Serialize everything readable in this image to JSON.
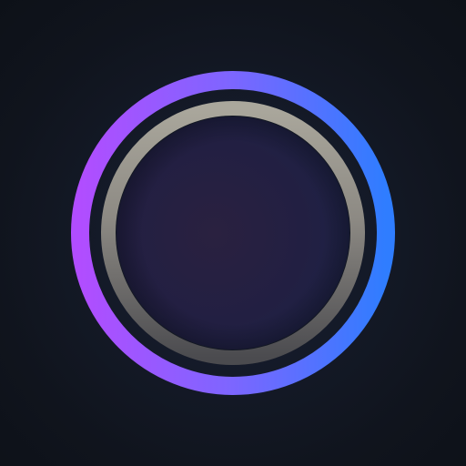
{
  "app": {
    "screen": "circular-button-icon"
  },
  "icon": {
    "outer_ring": "gradient-ring-icon",
    "inner_ring": "metallic-ring-icon",
    "center": "circle-button-icon"
  },
  "colors": {
    "background": "#111621",
    "outer_start": "#b14dff",
    "outer_end": "#2f7dff",
    "inner_top": "#aaa79c",
    "inner_bottom": "#4b4b4f",
    "center_left": "#2a2140",
    "center_right": "#1c2448"
  }
}
